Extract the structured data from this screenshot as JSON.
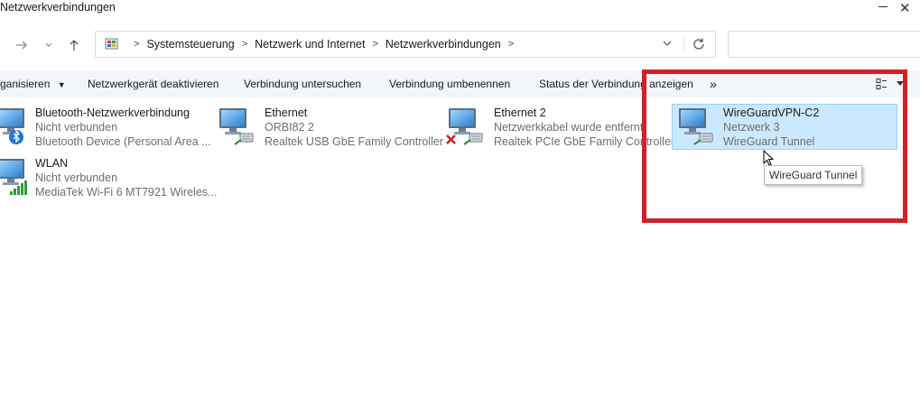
{
  "window": {
    "title": "Netzwerkverbindungen"
  },
  "address_bar": {
    "breadcrumbs": [
      "Systemsteuerung",
      "Netzwerk und Internet",
      "Netzwerkverbindungen"
    ]
  },
  "command_bar": {
    "items": [
      "ganisieren",
      "Netzwerkgerät deaktivieren",
      "Verbindung untersuchen",
      "Verbindung umbenennen",
      "Status der Verbindung anzeigen"
    ],
    "more": "»"
  },
  "connections": [
    {
      "name": "Bluetooth-Netzwerkverbindung",
      "status": "Nicht verbunden",
      "device": "Bluetooth Device (Personal Area ..."
    },
    {
      "name": "Ethernet",
      "status": "ORBI82 2",
      "device": "Realtek USB GbE Family Controller"
    },
    {
      "name": "Ethernet 2",
      "status": "Netzwerkkabel wurde entfernt",
      "device": "Realtek PCIe GbE Family Controller"
    },
    {
      "name": "WireGuardVPN-C2",
      "status": "Netzwerk 3",
      "device": "WireGuard Tunnel"
    },
    {
      "name": "WLAN",
      "status": "Nicht verbunden",
      "device": "MediaTek Wi-Fi 6 MT7921 Wireles..."
    }
  ],
  "tooltip": {
    "text": "WireGuard Tunnel"
  },
  "colors": {
    "selection": "#cce8ff",
    "highlight_box": "#d42029",
    "command_bar": "#f2f5f9"
  }
}
